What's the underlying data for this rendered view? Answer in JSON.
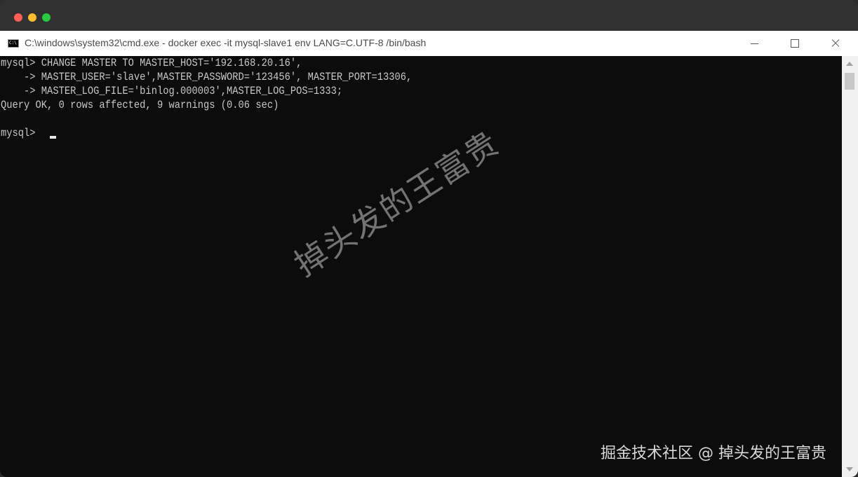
{
  "window": {
    "title": "C:\\windows\\system32\\cmd.exe - docker  exec -it mysql-slave1 env LANG=C.UTF-8 /bin/bash",
    "icon": "cmd-icon"
  },
  "console": {
    "lines": [
      "mysql> CHANGE MASTER TO MASTER_HOST='192.168.20.16',",
      "    -> MASTER_USER='slave',MASTER_PASSWORD='123456', MASTER_PORT=13306,",
      "    -> MASTER_LOG_FILE='binlog.000003',MASTER_LOG_POS=1333;",
      "Query OK, 0 rows affected, 9 warnings (0.06 sec)",
      "",
      "mysql> "
    ]
  },
  "watermark": {
    "center": "掉头发的王富贵",
    "corner": "掘金技术社区 @ 掉头发的王富贵"
  }
}
